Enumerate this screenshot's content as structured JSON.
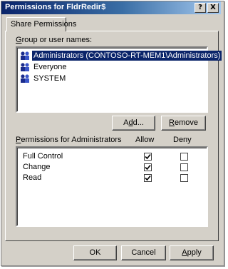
{
  "window": {
    "title": "Permissions for FldrRedir$",
    "help_glyph": "?",
    "close_glyph": "X"
  },
  "tab": {
    "label": "Share Permissions"
  },
  "groups": {
    "label_prefix": "",
    "label_mnemonic": "G",
    "label_rest": "roup or user names:",
    "items": [
      {
        "label": "Administrators (CONTOSO-RT-MEM1\\Administrators)",
        "icon": "user-group-icon",
        "selected": true
      },
      {
        "label": "Everyone",
        "icon": "user-group-icon",
        "selected": false
      },
      {
        "label": "SYSTEM",
        "icon": "user-group-icon",
        "selected": false
      }
    ]
  },
  "buttons": {
    "add_mnemonic": "d",
    "add_pre": "A",
    "add_post": "d...",
    "add_label_display": "Add...",
    "remove_mnemonic": "R",
    "remove_rest": "emove",
    "ok": "OK",
    "cancel": "Cancel",
    "apply_mnemonic": "A",
    "apply_rest": "pply"
  },
  "permissions": {
    "label_mnemonic": "P",
    "label_rest": "ermissions for Administrators",
    "allow_header": "Allow",
    "deny_header": "Deny",
    "rows": [
      {
        "name": "Full Control",
        "allow": true,
        "deny": false
      },
      {
        "name": "Change",
        "allow": true,
        "deny": false
      },
      {
        "name": "Read",
        "allow": true,
        "deny": false
      }
    ]
  },
  "colors": {
    "title_bar": "#0a246a",
    "dialog_face": "#d4d0c8",
    "selection": "#0a246a"
  }
}
